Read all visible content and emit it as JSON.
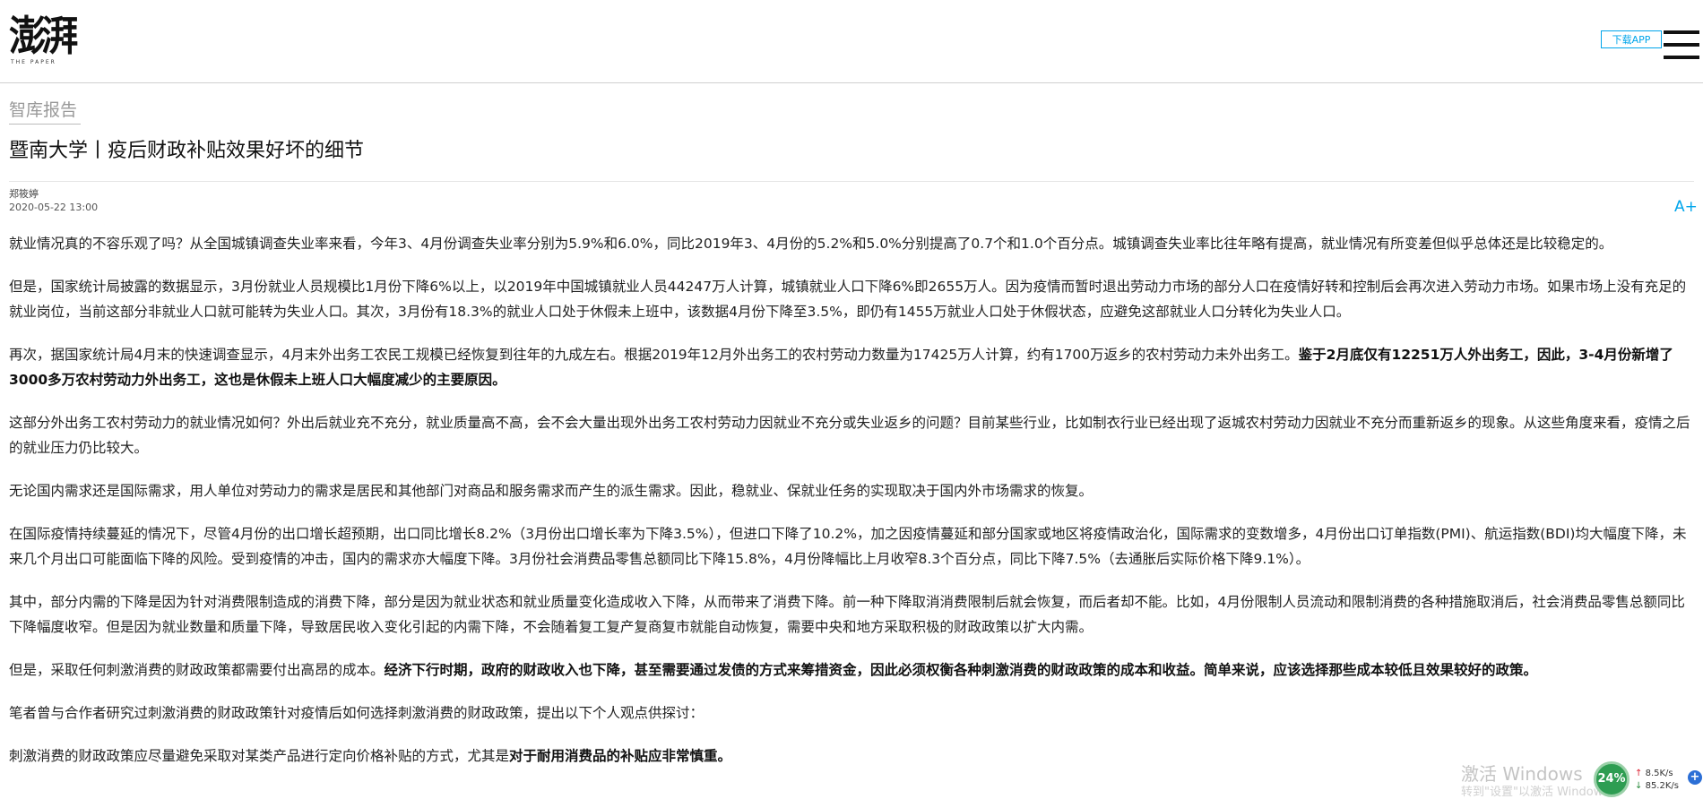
{
  "header": {
    "logo_text": "澎湃",
    "logo_sub": "THE PAPER",
    "download_label": "下载APP"
  },
  "section": {
    "label": "智库报告"
  },
  "article": {
    "title": "暨南大学丨疫后财政补贴效果好坏的细节",
    "author": "郑筱婷",
    "date": "2020-05-22 13:00",
    "font_size_label": "A+",
    "paragraphs": [
      {
        "segments": [
          {
            "text": "就业情况真的不容乐观了吗？从全国城镇调查失业率来看，今年3、4月份调查失业率分别为5.9%和6.0%，同比2019年3、4月份的5.2%和5.0%分别提高了0.7个和1.0个百分点。城镇调查失业率比往年略有提高，就业情况有所变差但似乎总体还是比较稳定的。",
            "bold": false
          }
        ]
      },
      {
        "segments": [
          {
            "text": "但是，国家统计局披露的数据显示，3月份就业人员规模比1月份下降6%以上，以2019年中国城镇就业人员44247万人计算，城镇就业人口下降6%即2655万人。因为疫情而暂时退出劳动力市场的部分人口在疫情好转和控制后会再次进入劳动力市场。如果市场上没有充足的就业岗位，当前这部分非就业人口就可能转为失业人口。其次，3月份有18.3%的就业人口处于休假未上班中，该数据4月份下降至3.5%，即仍有1455万就业人口处于休假状态，应避免这部就业人口分转化为失业人口。",
            "bold": false
          }
        ]
      },
      {
        "segments": [
          {
            "text": "再次，据国家统计局4月末的快速调查显示，4月末外出务工农民工规模已经恢复到往年的九成左右。根据2019年12月外出务工的农村劳动力数量为17425万人计算，约有1700万返乡的农村劳动力未外出务工。",
            "bold": false
          },
          {
            "text": "鉴于2月底仅有12251万人外出务工，因此，3-4月份新增了3000多万农村劳动力外出务工，这也是休假未上班人口大幅度减少的主要原因。",
            "bold": true
          }
        ]
      },
      {
        "segments": [
          {
            "text": "这部分外出务工农村劳动力的就业情况如何？外出后就业充不充分，就业质量高不高，会不会大量出现外出务工农村劳动力因就业不充分或失业返乡的问题？目前某些行业，比如制衣行业已经出现了返城农村劳动力因就业不充分而重新返乡的现象。从这些角度来看，疫情之后的就业压力仍比较大。",
            "bold": false
          }
        ]
      },
      {
        "segments": [
          {
            "text": "无论国内需求还是国际需求，用人单位对劳动力的需求是居民和其他部门对商品和服务需求而产生的派生需求。因此，稳就业、保就业任务的实现取决于国内外市场需求的恢复。",
            "bold": false
          }
        ]
      },
      {
        "segments": [
          {
            "text": "在国际疫情持续蔓延的情况下，尽管4月份的出口增长超预期，出口同比增长8.2%（3月份出口增长率为下降3.5%），但进口下降了10.2%，加之因疫情蔓延和部分国家或地区将疫情政治化，国际需求的变数增多，4月份出口订单指数(PMI)、航运指数(BDI)均大幅度下降，未来几个月出口可能面临下降的风险。受到疫情的冲击，国内的需求亦大幅度下降。3月份社会消费品零售总额同比下降15.8%，4月份降幅比上月收窄8.3个百分点，同比下降7.5%（去通胀后实际价格下降9.1%）。",
            "bold": false
          }
        ]
      },
      {
        "segments": [
          {
            "text": "其中，部分内需的下降是因为针对消费限制造成的消费下降，部分是因为就业状态和就业质量变化造成收入下降，从而带来了消费下降。前一种下降取消消费限制后就会恢复，而后者却不能。比如，4月份限制人员流动和限制消费的各种措施取消后，社会消费品零售总额同比下降幅度收窄。但是因为就业数量和质量下降，导致居民收入变化引起的内需下降，不会随着复工复产复商复市就能自动恢复，需要中央和地方采取积极的财政政策以扩大内需。",
            "bold": false
          }
        ]
      },
      {
        "segments": [
          {
            "text": "但是，采取任何刺激消费的财政政策都需要付出高昂的成本。",
            "bold": false
          },
          {
            "text": "经济下行时期，政府的财政收入也下降，甚至需要通过发债的方式来筹措资金，因此必须权衡各种刺激消费的财政政策的成本和收益。简单来说，应该选择那些成本较低且效果较好的政策。",
            "bold": true
          }
        ]
      },
      {
        "segments": [
          {
            "text": "笔者曾与合作者研究过刺激消费的财政政策针对疫情后如何选择刺激消费的财政政策，提出以下个人观点供探讨：",
            "bold": false
          }
        ]
      },
      {
        "segments": [
          {
            "text": "刺激消费的财政政策应尽量避免采取对某类产品进行定向价格补贴的方式，尤其是",
            "bold": false
          },
          {
            "text": "对于耐用消费品的补贴应非常慎重。",
            "bold": true
          }
        ]
      }
    ]
  },
  "overlay": {
    "watermark": "激活 Windows",
    "watermark_sub": "转到\"设置\"以激活 Windows。",
    "net_percent": "24%",
    "net_up": "8.5K/s",
    "net_down": "85.2K/s",
    "up_arrow": "↑",
    "down_arrow": "↓",
    "plus": "+"
  }
}
